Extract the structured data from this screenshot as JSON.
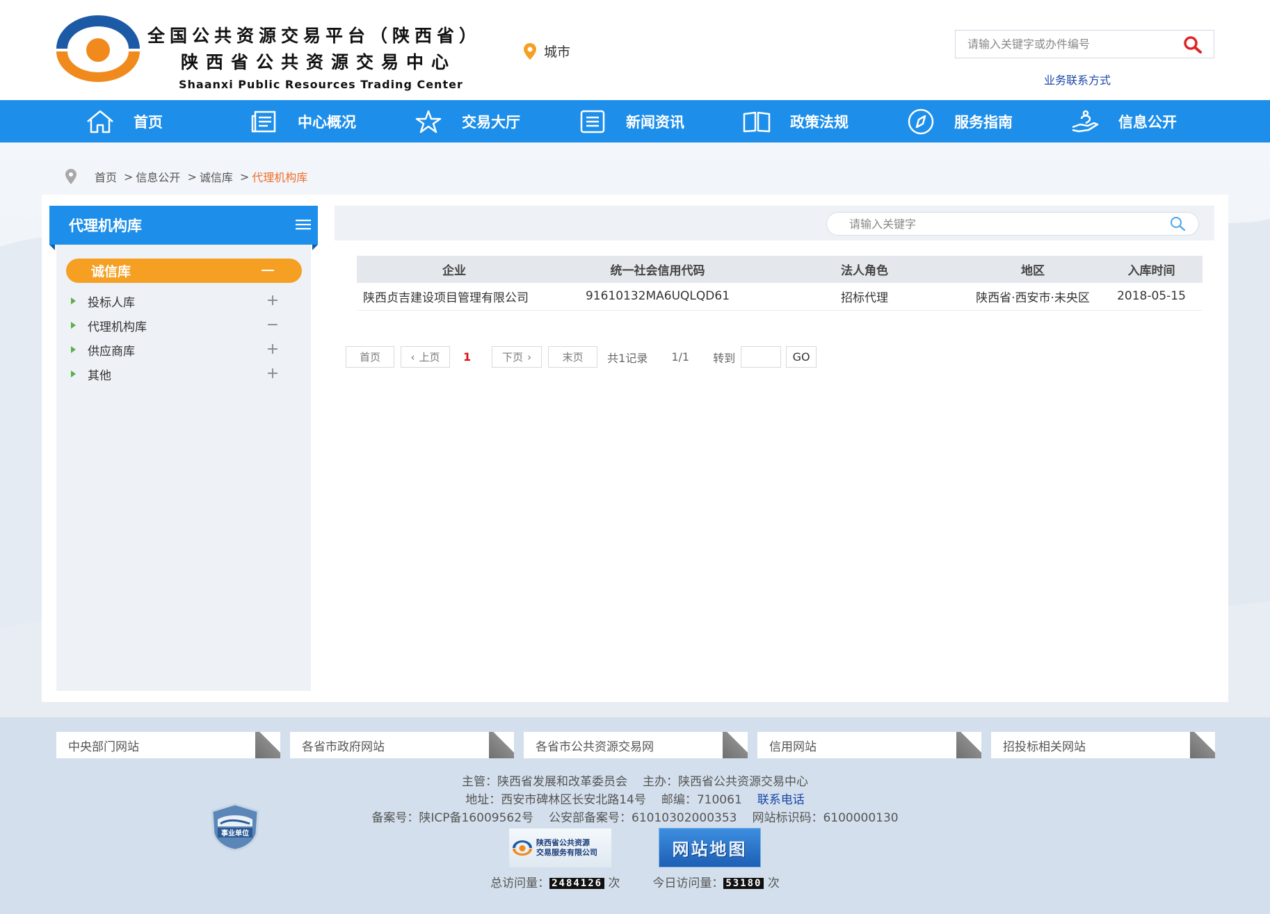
{
  "header": {
    "logo_cn_line1": "全国公共资源交易平台（陕西省）",
    "logo_cn_line2": "陕西省公共资源交易中心",
    "logo_en": "Shaanxi Public Resources Trading Center",
    "city_label": "城市",
    "search_placeholder": "请输入关键字或办件编号",
    "contact_link": "业务联系方式"
  },
  "nav": {
    "items": [
      {
        "label": "首页",
        "icon": "home-icon"
      },
      {
        "label": "中心概况",
        "icon": "document-icon"
      },
      {
        "label": "交易大厅",
        "icon": "star-icon"
      },
      {
        "label": "新闻资讯",
        "icon": "list-icon"
      },
      {
        "label": "政策法规",
        "icon": "book-icon"
      },
      {
        "label": "服务指南",
        "icon": "compass-icon"
      },
      {
        "label": "信息公开",
        "icon": "hand-icon"
      }
    ]
  },
  "breadcrumb": {
    "items": [
      "首页",
      "信息公开",
      "诚信库",
      "代理机构库"
    ],
    "separator": ">"
  },
  "sidebar": {
    "title": "代理机构库",
    "category": "诚信库",
    "items": [
      {
        "label": "投标人库",
        "toggle": "+"
      },
      {
        "label": "代理机构库",
        "toggle": "−"
      },
      {
        "label": "供应商库",
        "toggle": "+"
      },
      {
        "label": "其他",
        "toggle": "+"
      }
    ]
  },
  "content": {
    "search_placeholder": "请输入关键字",
    "table": {
      "columns": [
        "企业",
        "统一社会信用代码",
        "法人角色",
        "地区",
        "入库时间"
      ],
      "rows": [
        [
          "陕西贞吉建设项目管理有限公司",
          "91610132MA6UQLQD61",
          "招标代理",
          "陕西省·西安市·未央区",
          "2018-05-15"
        ]
      ]
    },
    "pager": {
      "first": "首页",
      "prev": "上页",
      "current": "1",
      "next": "下页",
      "last": "末页",
      "total": "共1记录",
      "page_of": "1/1",
      "goto": "转到",
      "go": "GO"
    }
  },
  "footer": {
    "links": [
      "中央部门网站",
      "各省市政府网站",
      "各省市公共资源交易网",
      "信用网站",
      "招投标相关网站"
    ],
    "line1_a": "主管：陕西省发展和改革委员会",
    "line1_b": "主办：陕西省公共资源交易中心",
    "line2_a": "地址：西安市碑林区长安北路14号",
    "line2_b": "邮编：710061",
    "line2_link": "联系电话",
    "line3_a": "备案号：陕ICP备16009562号",
    "line3_b": "公安部备案号：61010302000353",
    "line3_c": "网站标识码：6100000130",
    "badge_text": "事业单位",
    "logo1_line1": "陕西省公共资源",
    "logo1_line2": "交易服务有限公司",
    "logo2_text": "网站地图",
    "total_visits_label": "总访问量：",
    "total_visits": "2484126",
    "today_visits_label": "今日访问量：",
    "today_visits": "53180",
    "unit": "次"
  },
  "colors": {
    "primary": "#1d8ee9",
    "accent": "#f5a023",
    "breadcrumb_active": "#f06e2a",
    "link": "#1a46a6",
    "footer_bg": "#d3dfec"
  }
}
